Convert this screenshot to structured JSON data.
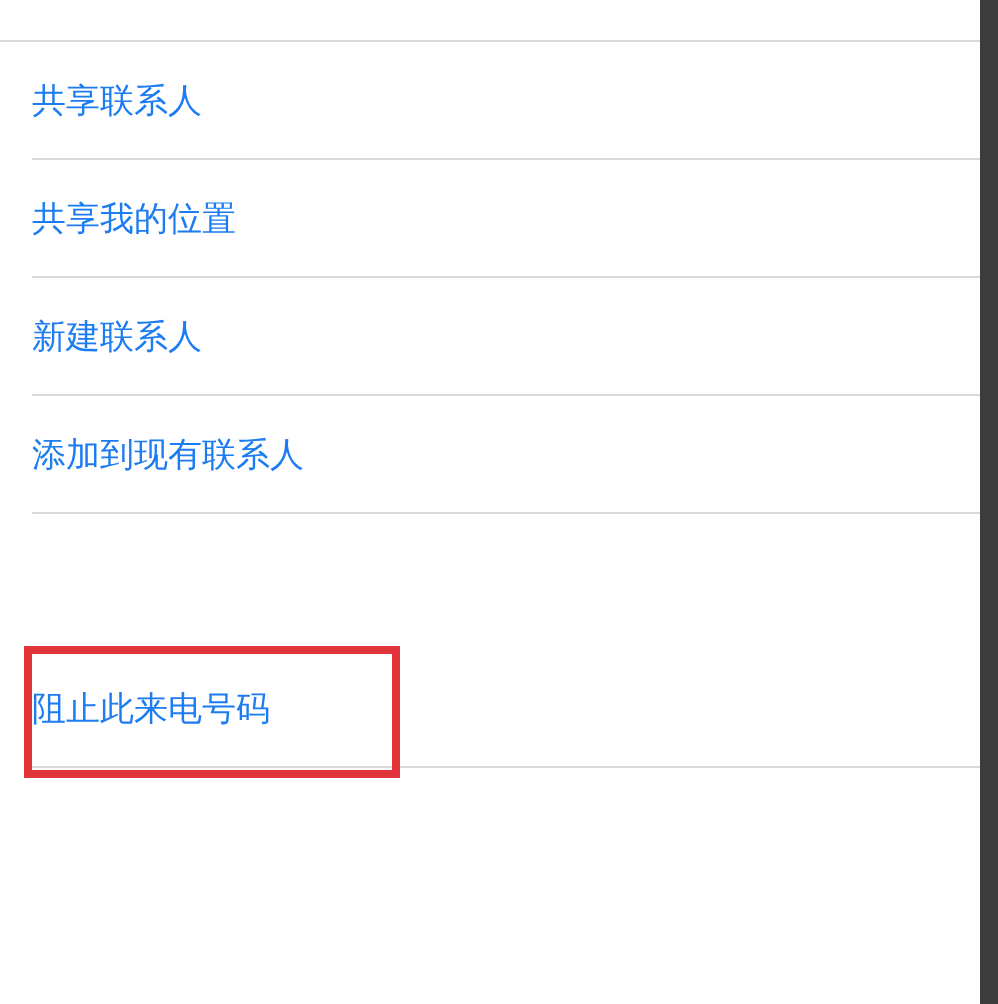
{
  "groups": [
    {
      "items": [
        {
          "label": "共享联系人",
          "highlighted": false
        },
        {
          "label": "共享我的位置",
          "highlighted": false
        },
        {
          "label": "新建联系人",
          "highlighted": false
        },
        {
          "label": "添加到现有联系人",
          "highlighted": false
        }
      ]
    },
    {
      "items": [
        {
          "label": "阻止此来电号码",
          "highlighted": true
        }
      ]
    }
  ]
}
